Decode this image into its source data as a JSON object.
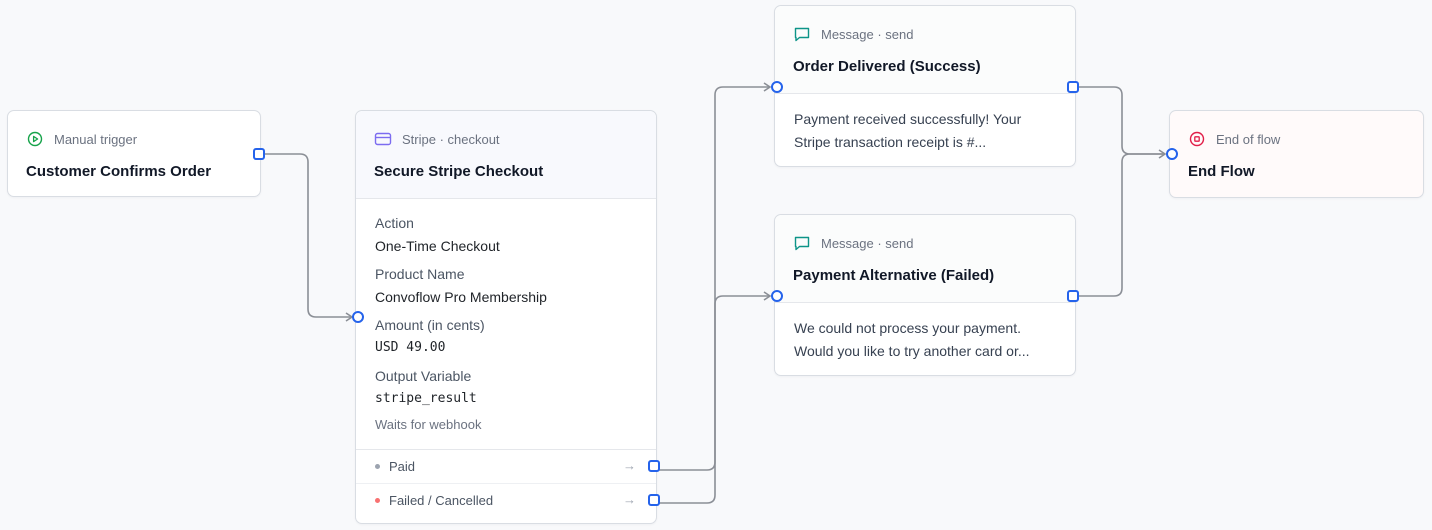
{
  "nodes": {
    "trigger": {
      "kind": "Manual trigger",
      "title": "Customer Confirms Order",
      "icon": "play-circle-icon",
      "accent": "#16a34a"
    },
    "stripe": {
      "kind": "Stripe · checkout",
      "title": "Secure Stripe Checkout",
      "icon": "credit-card-icon",
      "accent": "#7c6cf0",
      "fields": [
        {
          "label": "Action",
          "value": "One-Time Checkout",
          "mono": false
        },
        {
          "label": "Product Name",
          "value": "Convoflow Pro Membership",
          "mono": false
        },
        {
          "label": "Amount (in cents)",
          "value": "USD 49.00",
          "mono": true
        },
        {
          "label": "Output Variable",
          "value": "stripe_result",
          "mono": true
        }
      ],
      "note": "Waits for webhook",
      "outputs": [
        {
          "label": "Paid",
          "dot_color": "#9ca3af",
          "arrow": "→"
        },
        {
          "label": "Failed / Cancelled",
          "dot_color": "#f87171",
          "arrow": "→"
        }
      ]
    },
    "msg_success": {
      "kind": "Message · send",
      "title": "Order Delivered (Success)",
      "icon": "chat-bubble-icon",
      "accent": "#0d9488",
      "line1": "Payment received successfully! Your",
      "line2": "Stripe transaction receipt is #..."
    },
    "msg_failed": {
      "kind": "Message · send",
      "title": "Payment Alternative (Failed)",
      "icon": "chat-bubble-icon",
      "accent": "#0d9488",
      "line1": "We could not process your payment.",
      "line2": "Would you like to try another card or..."
    },
    "end": {
      "kind": "End of flow",
      "title": "End Flow",
      "icon": "stop-circle-icon",
      "accent": "#e11d48"
    }
  },
  "edge_color": "#8b8f96",
  "handle_color": "#2563eb"
}
